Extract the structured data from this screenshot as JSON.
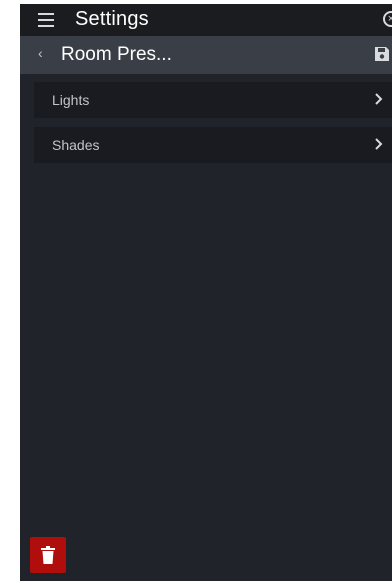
{
  "header": {
    "title": "Settings",
    "close_glyph": "×",
    "icons": [
      "hamburger-menu-icon",
      "close-circle-icon"
    ]
  },
  "subheader": {
    "back_glyph": "‹",
    "title": "Room Pres...",
    "icons": [
      "save-icon"
    ]
  },
  "list": {
    "items": [
      {
        "label": "Lights"
      },
      {
        "label": "Shades"
      }
    ]
  },
  "footer": {
    "delete_icon": "trash-icon",
    "delete_color": "#b00d0d"
  },
  "colors": {
    "background": "#202329",
    "titlebar": "#1a1c20",
    "subheader": "#3a3f47",
    "row": "#191b20"
  }
}
